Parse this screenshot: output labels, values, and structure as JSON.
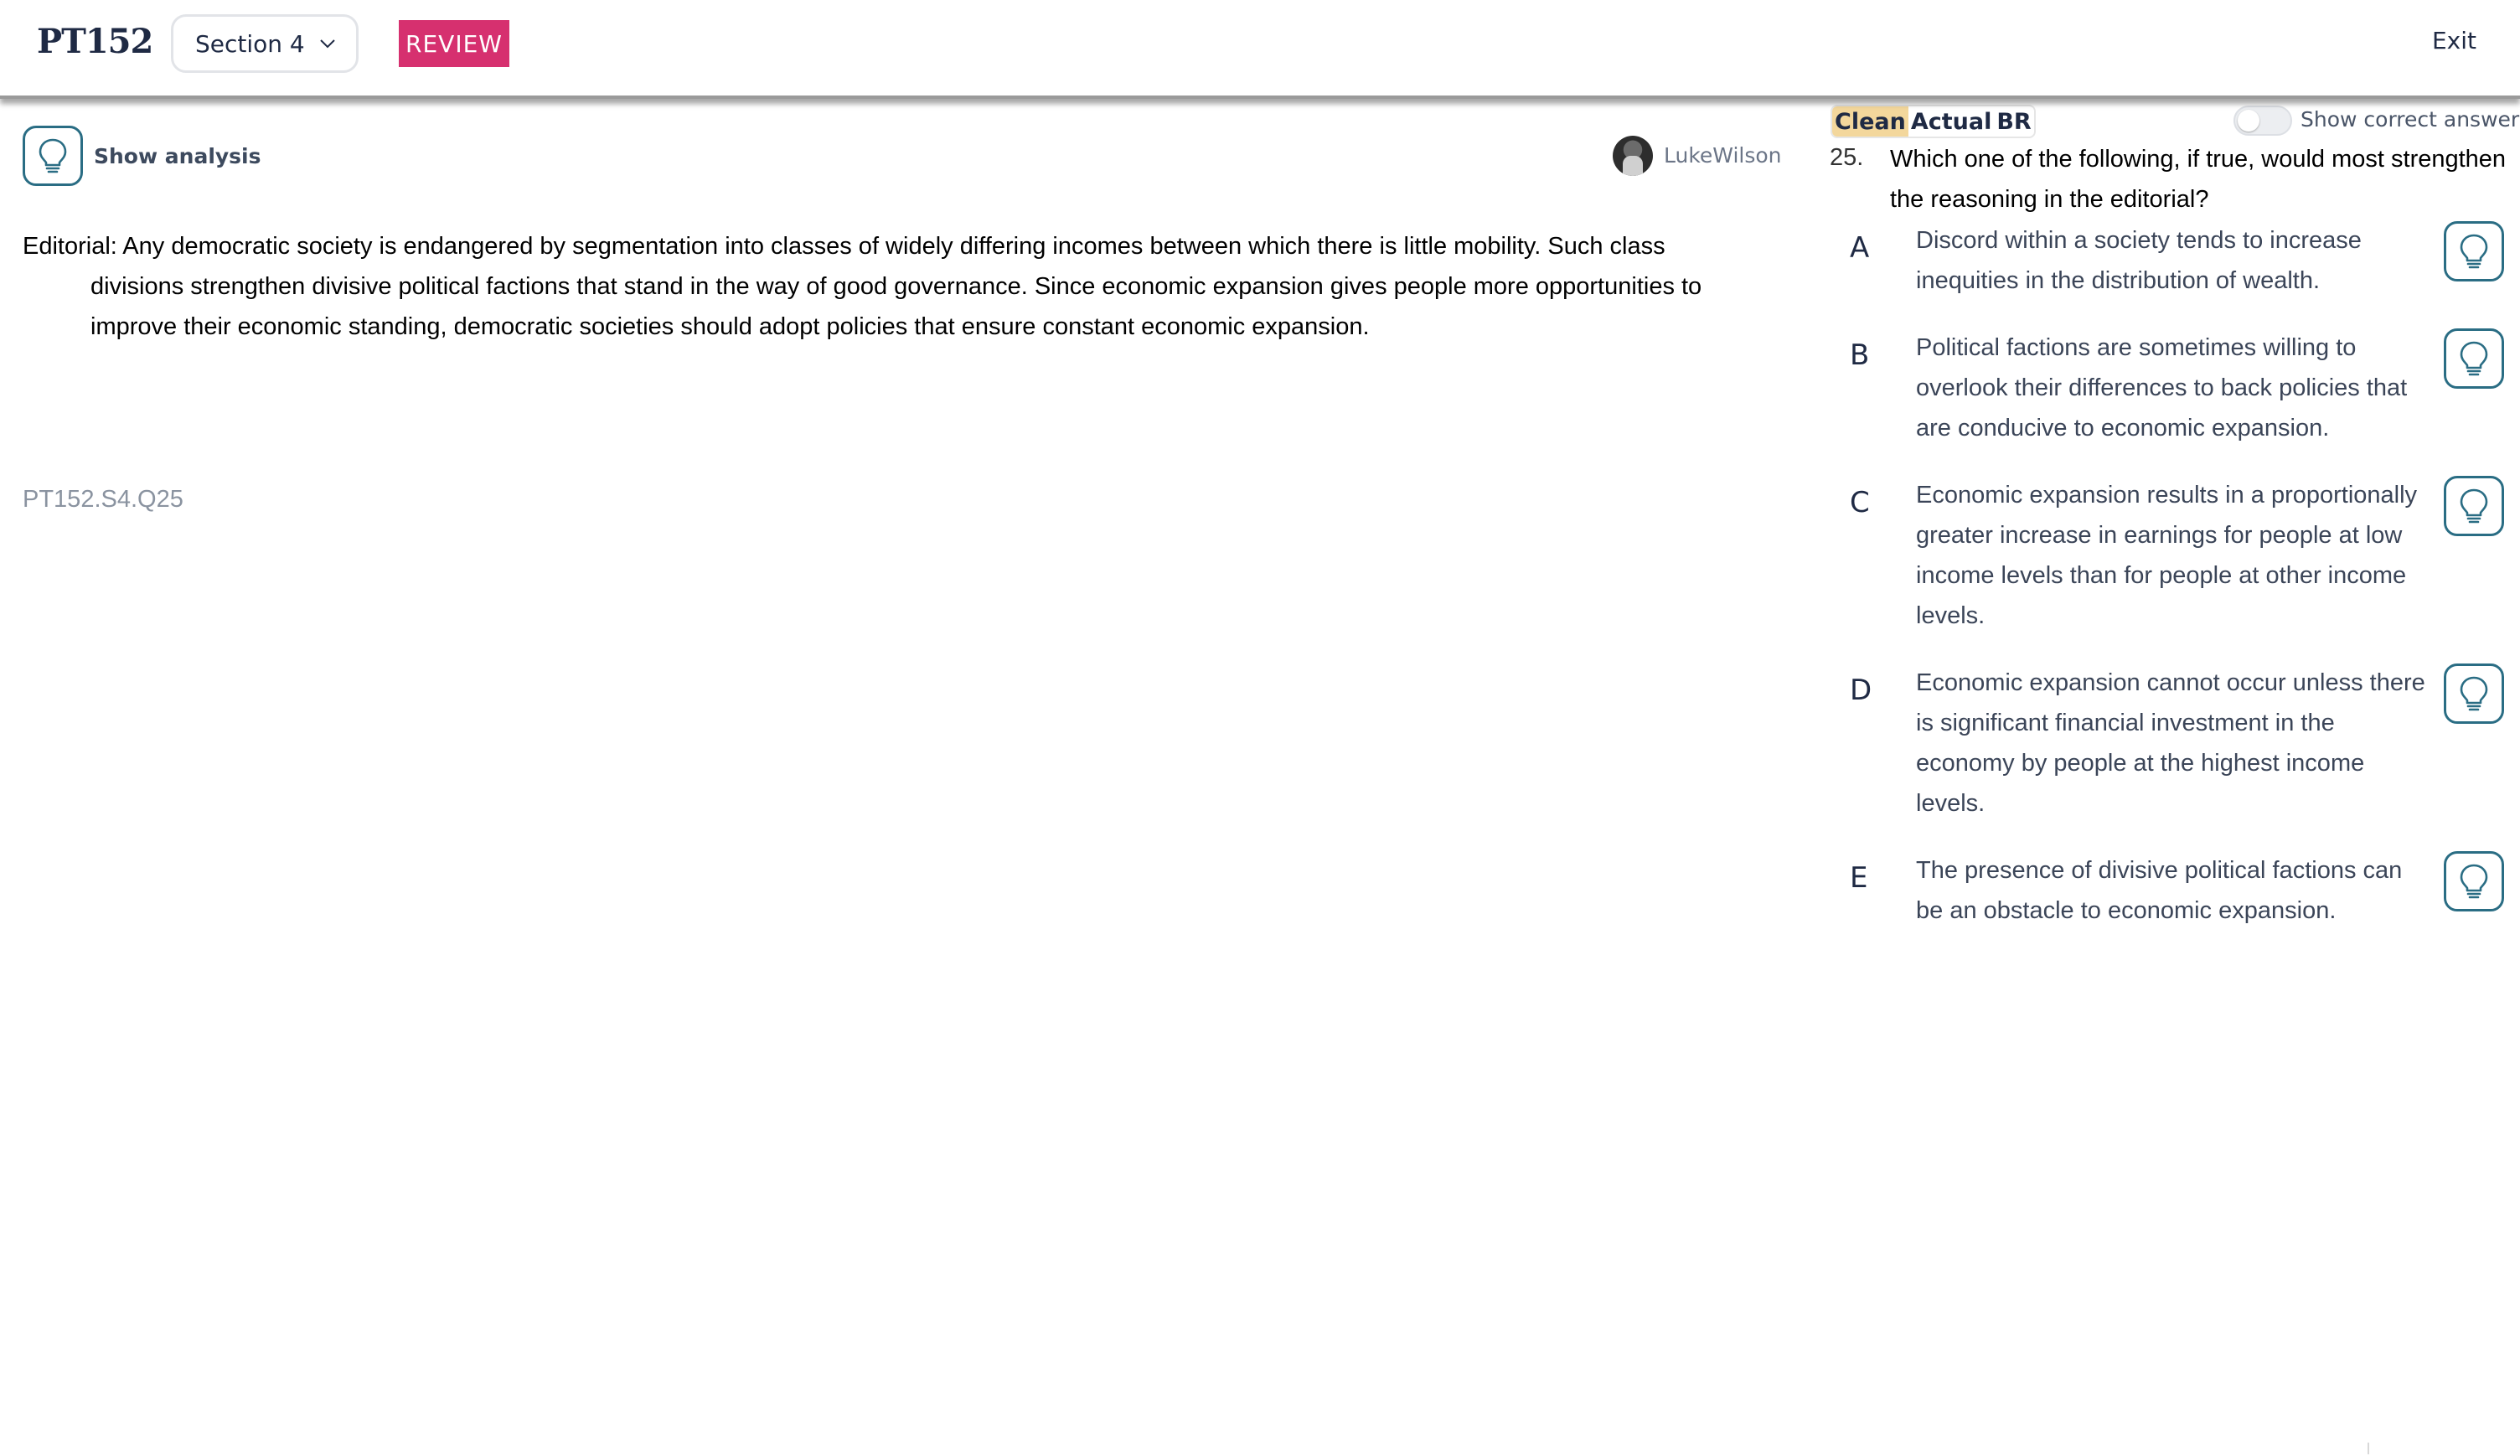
{
  "header": {
    "brand": "PT152",
    "section_label": "Section 4",
    "review_label": "REVIEW",
    "exit_label": "Exit"
  },
  "left": {
    "analysis_label": "Show analysis",
    "username": "LukeWilson",
    "passage": "Editorial: Any democratic society is endangered by segmentation into classes of widely differing incomes between which there is little mobility. Such class divisions strengthen divisive political factions that stand in the way of good governance. Since economic expansion gives people more opportunities to improve their economic standing, democratic societies should adopt policies that ensure constant economic expansion.",
    "question_id": "PT152.S4.Q25"
  },
  "right": {
    "mode_tabs": [
      "Clean",
      "Actual",
      "BR"
    ],
    "active_mode": "Clean",
    "toggle_label": "Show correct answer",
    "question_number": "25.",
    "question_stem": "Which one of the following, if true, would most strengthen the reasoning in the editorial?",
    "choices": [
      {
        "letter": "A",
        "text": "Discord within a society tends to increase inequities in the distribution of wealth."
      },
      {
        "letter": "B",
        "text": "Political factions are sometimes willing to overlook their differences to back policies that are conducive to economic expansion."
      },
      {
        "letter": "C",
        "text": "Economic expansion results in a proportionally greater increase in earnings for people at low income levels than for people at other income levels."
      },
      {
        "letter": "D",
        "text": "Economic expansion cannot occur unless there is significant financial investment in the economy by people at the highest income levels."
      },
      {
        "letter": "E",
        "text": "The presence of divisive political factions can be an obstacle to economic expansion."
      }
    ]
  },
  "colors": {
    "brand_text": "#1f2a44",
    "review_badge": "#d6306f",
    "bulb_outline": "#2a6d84",
    "active_mode_highlight": "#f3d79c"
  },
  "icons": {
    "section_dropdown": "chevron-down-icon",
    "analysis": "lightbulb-icon",
    "choice_hint": "lightbulb-icon"
  }
}
